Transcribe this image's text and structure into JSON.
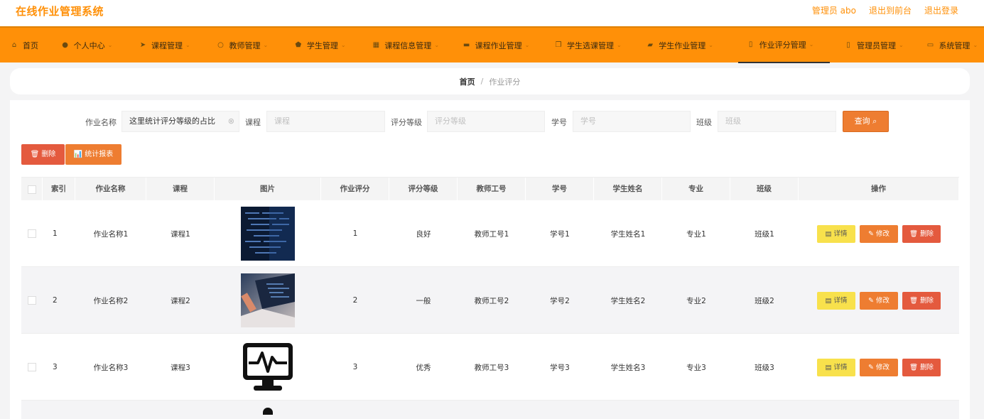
{
  "header": {
    "app_title": "在线作业管理系统",
    "links": [
      "管理员 abo",
      "退出到前台",
      "退出登录"
    ]
  },
  "nav": {
    "items": [
      {
        "label": "首页",
        "icon": "home-icon"
      },
      {
        "label": "个人中心",
        "icon": "user-icon"
      },
      {
        "label": "课程管理",
        "icon": "send-icon"
      },
      {
        "label": "教师管理",
        "icon": "circle-icon"
      },
      {
        "label": "学生管理",
        "icon": "shield-icon"
      },
      {
        "label": "课程信息管理",
        "icon": "grid-icon"
      },
      {
        "label": "课程作业管理",
        "icon": "chat-icon"
      },
      {
        "label": "学生选课管理",
        "icon": "copy-icon"
      },
      {
        "label": "学生作业管理",
        "icon": "bag-icon"
      },
      {
        "label": "作业评分管理",
        "icon": "doc-icon"
      },
      {
        "label": "管理员管理",
        "icon": "doc-icon"
      },
      {
        "label": "系统管理",
        "icon": "box-icon"
      }
    ],
    "active_index": 9
  },
  "breadcrumb": {
    "home": "首页",
    "sep": "/",
    "current": "作业评分"
  },
  "search": {
    "name_label": "作业名称",
    "name_value": "这里统计评分等级的占比",
    "course_label": "课程",
    "course_placeholder": "课程",
    "grade_label": "评分等级",
    "grade_placeholder": "评分等级",
    "sid_label": "学号",
    "sid_placeholder": "学号",
    "class_label": "班级",
    "class_placeholder": "班级",
    "button": "查询 ⌕"
  },
  "actions": {
    "delete": "🗑 删除",
    "report": "📊 统计报表"
  },
  "table": {
    "headers": [
      "索引",
      "作业名称",
      "课程",
      "图片",
      "作业评分",
      "评分等级",
      "教师工号",
      "学号",
      "学生姓名",
      "专业",
      "班级",
      "操作"
    ],
    "rows": [
      {
        "idx": "1",
        "name": "作业名称1",
        "course": "课程1",
        "score": "1",
        "grade": "良好",
        "tid": "教师工号1",
        "sid": "学号1",
        "sname": "学生姓名1",
        "major": "专业1",
        "cls": "班级1",
        "img": "code-screen"
      },
      {
        "idx": "2",
        "name": "作业名称2",
        "course": "课程2",
        "score": "2",
        "grade": "一般",
        "tid": "教师工号2",
        "sid": "学号2",
        "sname": "学生姓名2",
        "major": "专业2",
        "cls": "班级2",
        "img": "laptop-photo"
      },
      {
        "idx": "3",
        "name": "作业名称3",
        "course": "课程3",
        "score": "3",
        "grade": "优秀",
        "tid": "教师工号3",
        "sid": "学号3",
        "sname": "学生姓名3",
        "major": "专业3",
        "cls": "班级3",
        "img": "monitor-icon"
      }
    ],
    "row_buttons": {
      "detail": "详情",
      "edit": "修改",
      "delete": "删除"
    }
  },
  "colors": {
    "brand": "#ff9008",
    "accent": "#ee7d31",
    "danger": "#e45a3e",
    "warning": "#f8e14c"
  }
}
